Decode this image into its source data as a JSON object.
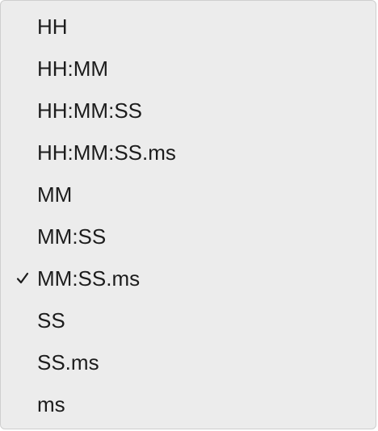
{
  "menu": {
    "items": [
      {
        "label": "HH",
        "checked": false
      },
      {
        "label": "HH:MM",
        "checked": false
      },
      {
        "label": "HH:MM:SS",
        "checked": false
      },
      {
        "label": "HH:MM:SS.ms",
        "checked": false
      },
      {
        "label": "MM",
        "checked": false
      },
      {
        "label": "MM:SS",
        "checked": false
      },
      {
        "label": "MM:SS.ms",
        "checked": true
      },
      {
        "label": "SS",
        "checked": false
      },
      {
        "label": "SS.ms",
        "checked": false
      },
      {
        "label": "ms",
        "checked": false
      }
    ],
    "checkmark_icon": "checkmark-icon",
    "colors": {
      "background": "#ececec",
      "text": "#1c1c1c",
      "border": "#cfcfcf"
    }
  }
}
